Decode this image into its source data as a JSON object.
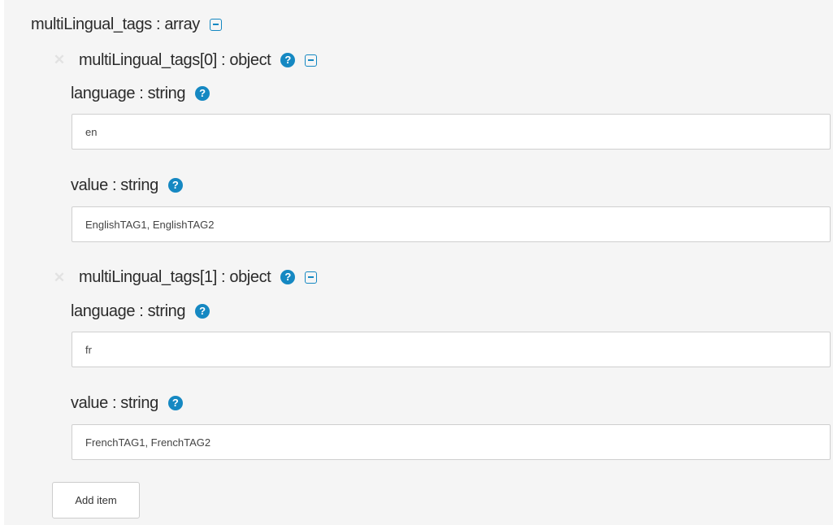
{
  "array": {
    "title": "multiLingual_tags : array"
  },
  "items": [
    {
      "title": "multiLingual_tags[0] : object",
      "language_label": "language : string",
      "language_value": "en",
      "value_label": "value : string",
      "value_value": "EnglishTAG1, EnglishTAG2"
    },
    {
      "title": "multiLingual_tags[1] : object",
      "language_label": "language : string",
      "language_value": "fr",
      "value_label": "value : string",
      "value_value": "FrenchTAG1, FrenchTAG2"
    }
  ],
  "add_button_label": "Add item",
  "icons": {
    "remove": "close-icon",
    "help": "question-circle-icon",
    "collapse": "minus-square-icon"
  },
  "colors": {
    "accent": "#1588c2",
    "panel_bg": "#f5f5f5",
    "text": "#2b2b2b",
    "remove_icon": "#e2e2e2"
  }
}
